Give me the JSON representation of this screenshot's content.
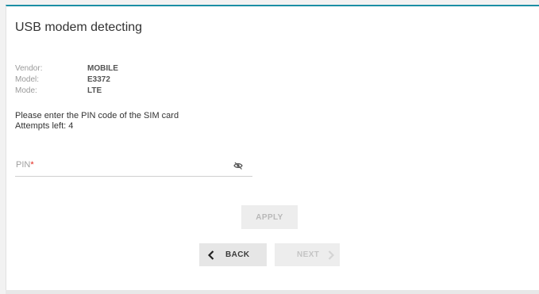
{
  "page": {
    "title": "USB modem detecting"
  },
  "modem_info": {
    "vendor_label": "Vendor:",
    "vendor_value": "MOBILE",
    "model_label": "Model:",
    "model_value": "E3372",
    "mode_label": "Mode:",
    "mode_value": "LTE"
  },
  "message": {
    "line1": "Please enter the PIN code of the SIM card",
    "line2": "Attempts left: 4"
  },
  "pin_field": {
    "label": "PIN",
    "required_mark": "*",
    "value": "",
    "visibility_icon": "eye-off-icon"
  },
  "buttons": {
    "apply_label": "APPLY",
    "back_label": "BACK",
    "next_label": "NEXT"
  },
  "colors": {
    "accent": "#1b8ea4",
    "required": "#e2241a",
    "disabled_button_bg": "#ededed",
    "disabled_button_text": "#b8b8b8",
    "active_button_bg": "#e6e6e6"
  }
}
